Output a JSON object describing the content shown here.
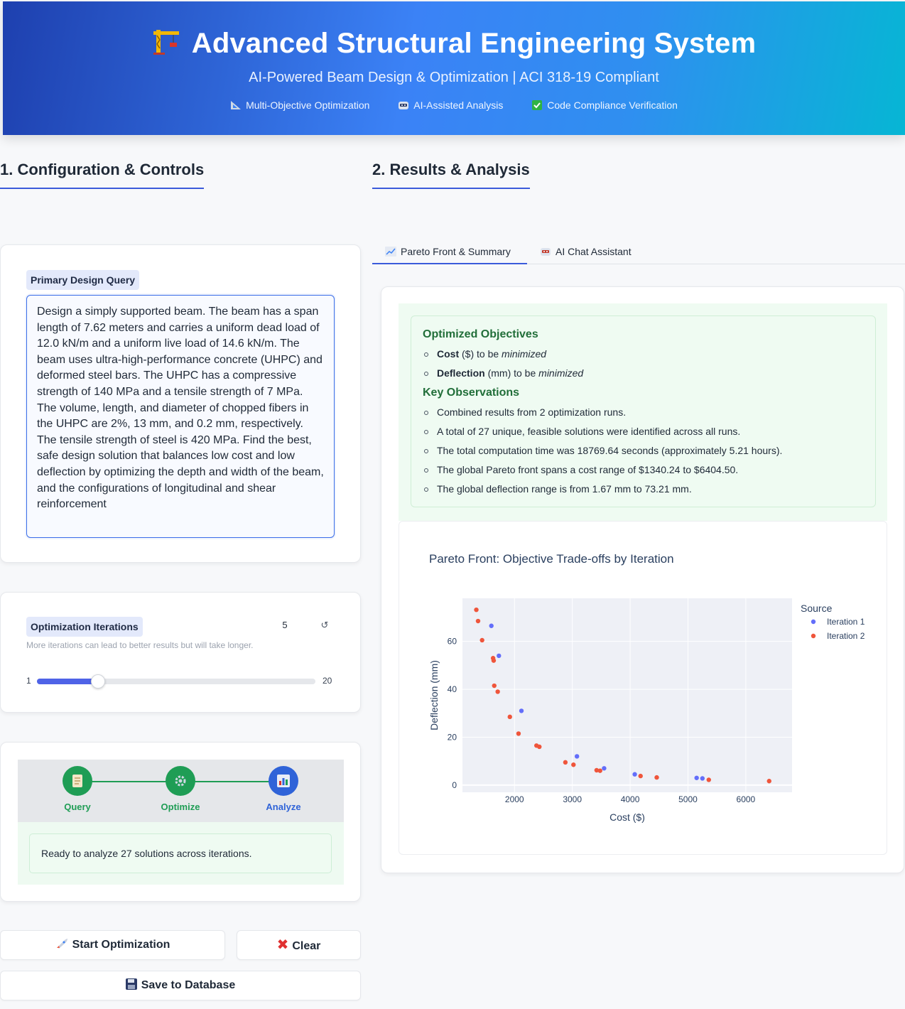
{
  "header": {
    "title": "Advanced Structural Engineering System",
    "subtitle": "AI-Powered Beam Design & Optimization | ACI 318-19 Compliant",
    "features": [
      {
        "icon": "ruler-icon",
        "label": "Multi-Objective Optimization"
      },
      {
        "icon": "robot-icon",
        "label": "AI-Assisted Analysis"
      },
      {
        "icon": "check-icon",
        "label": "Code Compliance Verification"
      }
    ]
  },
  "left": {
    "section_title": "1. Configuration & Controls",
    "query_label": "Primary Design Query",
    "query_text": "Design a simply supported beam. The beam has a span length of 7.62 meters and carries a uniform dead load of 12.0 kN/m and a uniform live load of 14.6 kN/m. The beam uses ultra-high-performance concrete (UHPC) and deformed steel bars. The UHPC has a compressive strength of 140 MPa and a tensile strength of 7 MPa. The volume, length, and diameter of chopped fibers in the UHPC are 2%, 13 mm, and 0.2 mm, respectively. The tensile strength of steel is 420 MPa. Find the best, safe design solution that balances low cost and low deflection by optimizing the depth and width of the beam, and the configurations of longitudinal and shear reinforcement",
    "iterations_label": "Optimization Iterations",
    "iterations_value": "5",
    "iterations_info": "More iterations can lead to better results but will take longer.",
    "slider_min": "1",
    "slider_max": "20",
    "slider_fraction": 0.22,
    "steps": [
      {
        "label": "Query",
        "icon": "document-icon"
      },
      {
        "label": "Optimize",
        "icon": "gear-icon"
      },
      {
        "label": "Analyze",
        "icon": "chart-icon"
      }
    ],
    "status_message": "Ready to analyze 27 solutions across iterations.",
    "start_button": "Start Optimization",
    "clear_button": "Clear",
    "save_button": "Save to Database"
  },
  "right": {
    "section_title": "2. Results & Analysis",
    "tabs": [
      {
        "label": "Pareto Front & Summary",
        "icon": "chart-line-icon",
        "active": true
      },
      {
        "label": "AI Chat Assistant",
        "icon": "robot-icon",
        "active": false
      }
    ],
    "objectives_heading": "Optimized Objectives",
    "objectives": [
      {
        "name": "Cost",
        "unit": "($) to be",
        "goal": "minimized"
      },
      {
        "name": "Deflection",
        "unit": "(mm) to be",
        "goal": "minimized"
      }
    ],
    "observations_heading": "Key Observations",
    "observations": [
      "Combined results from 2 optimization runs.",
      "A total of 27 unique, feasible solutions were identified across all runs.",
      "The total computation time was 18769.64 seconds (approximately 5.21 hours).",
      "The global Pareto front spans a cost range of $1340.24 to $6404.50.",
      "The global deflection range is from 1.67 mm to 73.21 mm."
    ]
  },
  "chart_data": {
    "type": "scatter",
    "title": "Pareto Front: Objective Trade-offs by Iteration",
    "xlabel": "Cost ($)",
    "ylabel": "Deflection (mm)",
    "xlim": [
      1100,
      6800
    ],
    "ylim": [
      -3,
      78
    ],
    "xticks": [
      2000,
      3000,
      4000,
      5000,
      6000
    ],
    "yticks": [
      0,
      20,
      40,
      60
    ],
    "legend_title": "Source",
    "legend_position": "top-right",
    "grid": true,
    "series": [
      {
        "name": "Iteration 1",
        "color": "#636efa",
        "x": [
          1600,
          1730,
          2120,
          3080,
          3550,
          4080,
          5150,
          5250
        ],
        "y": [
          66.5,
          54,
          31,
          12,
          7,
          4.5,
          3,
          2.8
        ]
      },
      {
        "name": "Iteration 2",
        "color": "#ef553b",
        "x": [
          1340,
          1370,
          1440,
          1630,
          1640,
          1650,
          1710,
          1920,
          2070,
          2380,
          2430,
          2880,
          3020,
          3420,
          3480,
          4180,
          4460,
          5360,
          6404
        ],
        "y": [
          73.2,
          68.5,
          60.5,
          53,
          52,
          41.5,
          39,
          28.5,
          21.5,
          16.5,
          16,
          9.5,
          8.5,
          6.2,
          6,
          3.8,
          3.2,
          2.2,
          1.67
        ]
      }
    ]
  }
}
